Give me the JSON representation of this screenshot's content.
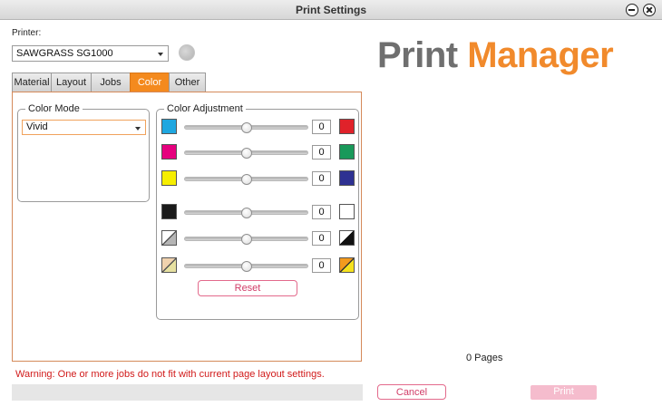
{
  "window": {
    "title": "Print Settings"
  },
  "printer": {
    "label": "Printer:",
    "selected": "SAWGRASS SG1000"
  },
  "brand": {
    "part1": "Print",
    "part2": "Manager"
  },
  "tabs": [
    {
      "label": "Material",
      "active": false
    },
    {
      "label": "Layout",
      "active": false
    },
    {
      "label": "Jobs",
      "active": false
    },
    {
      "label": "Color",
      "active": true
    },
    {
      "label": "Other",
      "active": false
    }
  ],
  "color_mode": {
    "legend": "Color Mode",
    "selected": "Vivid"
  },
  "color_adjustment": {
    "legend": "Color Adjustment",
    "rows": [
      {
        "left": "cyan",
        "right": "red",
        "value": "0",
        "level": 0.5
      },
      {
        "left": "magenta",
        "right": "green",
        "value": "0",
        "level": 0.5
      },
      {
        "left": "yellow",
        "right": "blue",
        "value": "0",
        "level": 0.5
      },
      {
        "left": "black",
        "right": "white",
        "value": "0",
        "level": 0.5
      },
      {
        "left": "contrast-gray",
        "right": "contrast-black",
        "value": "0",
        "level": 0.5
      },
      {
        "left": "saturation-tan",
        "right": "saturation-orange",
        "value": "0",
        "level": 0.5
      }
    ],
    "reset_label": "Reset"
  },
  "status": {
    "pages": "0 Pages",
    "warning": "Warning:  One or more jobs do not fit with current page layout settings.",
    "progress": 0
  },
  "buttons": {
    "cancel": "Cancel",
    "print": "Print"
  },
  "colors": {
    "accent": "#f48a1e",
    "brand_gray": "#6f6f6f",
    "brand_orange": "#f18a2c",
    "warning": "#d11a1a",
    "button_pink": "#d13d68",
    "cyan": "#1fa7e0",
    "red": "#e0222a",
    "magenta": "#e6007e",
    "green": "#19995a",
    "yellow": "#f6ee00",
    "blue": "#2e3192",
    "black": "#1a1a1a",
    "white": "#ffffff"
  }
}
